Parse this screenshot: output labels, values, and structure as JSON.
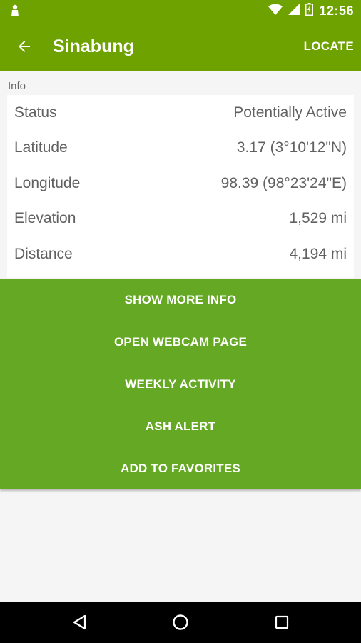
{
  "status_bar": {
    "time": "12:56",
    "icons": [
      "notification-icon",
      "wifi-icon",
      "cell-signal-icon",
      "battery-icon"
    ]
  },
  "app_bar": {
    "title": "Sinabung",
    "action_label": "LOCATE",
    "back_icon": "arrow-back-icon"
  },
  "info": {
    "section_label": "Info",
    "rows": [
      {
        "label": "Status",
        "value": "Potentially Active"
      },
      {
        "label": "Latitude",
        "value": "3.17 (3°10'12\"N)"
      },
      {
        "label": "Longitude",
        "value": "98.39 (98°23'24\"E)"
      },
      {
        "label": "Elevation",
        "value": "1,529  mi"
      },
      {
        "label": "Distance",
        "value": "4,194  mi"
      }
    ]
  },
  "actions": [
    {
      "label": "SHOW MORE INFO"
    },
    {
      "label": "OPEN WEBCAM PAGE"
    },
    {
      "label": "WEEKLY ACTIVITY"
    },
    {
      "label": "ASH ALERT"
    },
    {
      "label": "ADD TO FAVORITES"
    }
  ],
  "nav_bar": {
    "icons": [
      "back-triangle-icon",
      "home-circle-icon",
      "recents-square-icon"
    ]
  },
  "colors": {
    "primary": "#6ea200",
    "actions_bg": "#65a824",
    "background": "#f5f5f5"
  }
}
